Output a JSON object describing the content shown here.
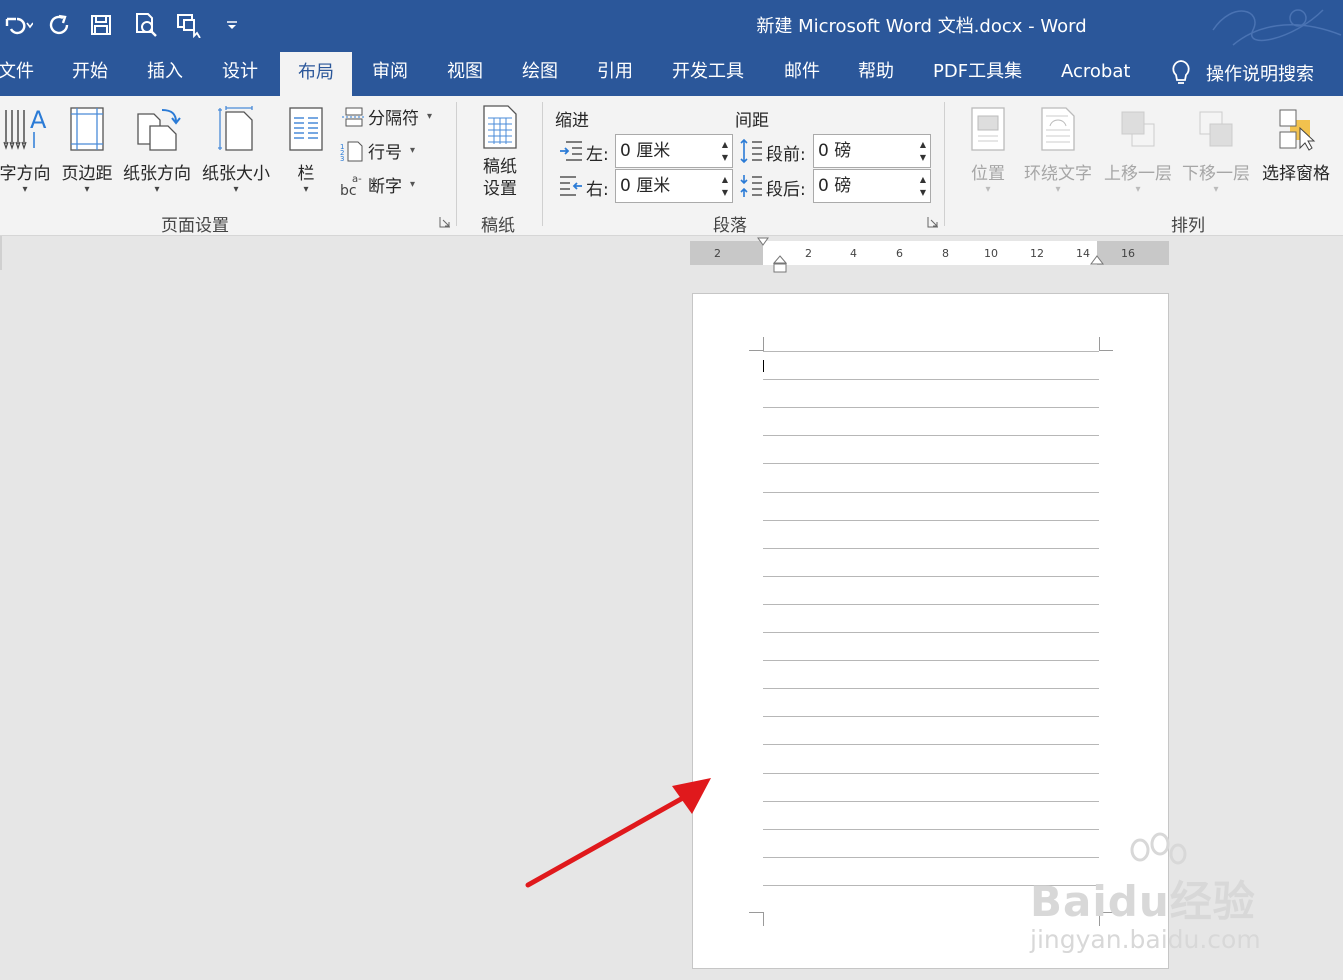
{
  "window": {
    "title": "新建 Microsoft Word 文档.docx  -  Word"
  },
  "colors": {
    "accent": "#2b579a",
    "ribbon_bg": "#f3f3f3",
    "workspace_bg": "#e6e6e6",
    "arrow": "#e0191c"
  },
  "quick_access": [
    "undo-icon",
    "redo-icon",
    "save-icon",
    "print-preview-icon",
    "touch-mode-icon",
    "customize-dropdown-icon"
  ],
  "tabs": [
    {
      "label": "文件",
      "active": false
    },
    {
      "label": "开始",
      "active": false
    },
    {
      "label": "插入",
      "active": false
    },
    {
      "label": "设计",
      "active": false
    },
    {
      "label": "布局",
      "active": true
    },
    {
      "label": "审阅",
      "active": false
    },
    {
      "label": "视图",
      "active": false
    },
    {
      "label": "绘图",
      "active": false
    },
    {
      "label": "引用",
      "active": false
    },
    {
      "label": "开发工具",
      "active": false
    },
    {
      "label": "邮件",
      "active": false
    },
    {
      "label": "帮助",
      "active": false
    },
    {
      "label": "PDF工具集",
      "active": false
    },
    {
      "label": "Acrobat",
      "active": false
    }
  ],
  "tell_me": {
    "label": "操作说明搜索"
  },
  "ribbon": {
    "page_setup": {
      "label": "页面设置",
      "text_direction": "字方向",
      "margins": "页边距",
      "orientation": "纸张方向",
      "size": "纸张大小",
      "columns": "栏",
      "breaks": "分隔符",
      "line_numbers": "行号",
      "hyphenation": "断字"
    },
    "manuscript": {
      "label": "稿纸",
      "setup_line1": "稿纸",
      "setup_line2": "设置"
    },
    "paragraph": {
      "label": "段落",
      "indent_title": "缩进",
      "spacing_title": "间距",
      "left_label": "左:",
      "left_value": "0 厘米",
      "right_label": "右:",
      "right_value": "0 厘米",
      "before_label": "段前:",
      "before_value": "0 磅",
      "after_label": "段后:",
      "after_value": "0 磅"
    },
    "arrange": {
      "label": "排列",
      "position": "位置",
      "wrap_text": "环绕文字",
      "bring_forward": "上移一层",
      "send_backward": "下移一层",
      "selection_pane": "选择窗格"
    }
  },
  "ruler": {
    "labels": [
      "2",
      "2",
      "4",
      "6",
      "8",
      "10",
      "12",
      "14",
      "16"
    ]
  },
  "watermark": {
    "logo": "Baidu经验",
    "url": "jingyan.baidu.com"
  }
}
